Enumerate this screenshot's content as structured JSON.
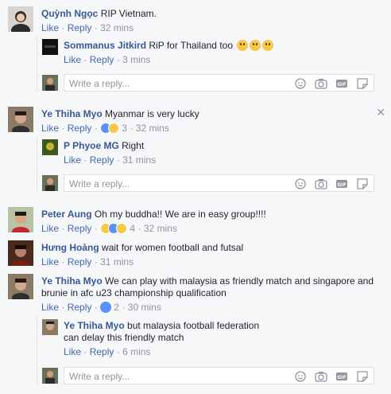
{
  "actions": {
    "like": "Like",
    "reply": "Reply",
    "sep": "·"
  },
  "reply_placeholder": "Write a reply...",
  "comments": [
    {
      "name": "Quỳnh Ngọc",
      "text": "RIP Vietnam.",
      "time": "32 mins"
    },
    {
      "name": "Sommanus Jitkird",
      "text": "RiP for Thailand too",
      "time": "3 mins",
      "emojis": [
        "sweat-smile",
        "sweat-smile",
        "unamused"
      ]
    },
    {
      "name": "Ye Thiha Myo",
      "text": "Myanmar is very lucky",
      "reactions": "3",
      "time": "32 mins"
    },
    {
      "name": "P Phyoe MG",
      "text": "Right",
      "time": "31 mins"
    },
    {
      "name": "Peter Aung",
      "text": "Oh my buddha!! We are in easy group!!!!",
      "reactions": "4",
      "time": "32 mins"
    },
    {
      "name": "Hưng Hoàng",
      "text": "wait for women football and futsal",
      "time": "31 mins"
    },
    {
      "name": "Ye Thiha Myo",
      "text_line1": "We can play with malaysia as friendly match and singapore and",
      "text_line2": "brunie in afc u23 championship qualification",
      "reactions": "2",
      "time": "30 mins"
    },
    {
      "name": "Ye Thiha Myo",
      "text_line1": "but malaysia football federation",
      "text_line2": "can delay this friendly match",
      "time": "6 mins"
    }
  ],
  "colors": {
    "link": "#365899",
    "accent": "#4267b2",
    "muted": "#90949c",
    "bg": "#f6f7f9"
  }
}
